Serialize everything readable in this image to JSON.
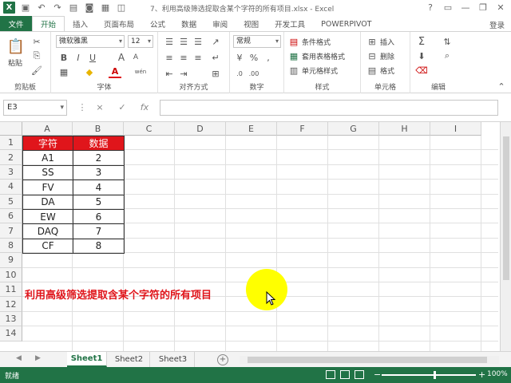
{
  "app": {
    "logo_letter": "X",
    "title": "7、利用高级筛选提取含某个字符的所有项目.xlsx - Excel",
    "login": "登录"
  },
  "quick_access": [
    "save-icon",
    "undo-icon",
    "redo-icon",
    "open-icon",
    "camera-icon",
    "print-icon",
    "preview-icon"
  ],
  "tabs": [
    "文件",
    "开始",
    "插入",
    "页面布局",
    "公式",
    "数据",
    "审阅",
    "视图",
    "开发工具",
    "POWERPIVOT"
  ],
  "active_tab": "开始",
  "ribbon": {
    "clipboard": {
      "label": "剪贴板",
      "paste": "粘贴"
    },
    "font": {
      "label": "字体",
      "font_name": "微软雅黑",
      "font_size": "12",
      "bold": "B",
      "italic": "I",
      "underline": "U",
      "grow": "A",
      "shrink": "A",
      "font_color_letter": "A",
      "wen": "wén"
    },
    "alignment": {
      "label": "对齐方式"
    },
    "number": {
      "label": "数字",
      "format": "常规"
    },
    "styles": {
      "label": "样式",
      "conditional": "条件格式",
      "table": "套用表格格式",
      "cell_styles": "单元格样式"
    },
    "cells": {
      "label": "单元格",
      "insert": "插入",
      "delete": "删除",
      "format": "格式"
    },
    "editing": {
      "label": "编辑"
    }
  },
  "formula_bar": {
    "name_box": "E3",
    "cancel": "×",
    "enter": "✓",
    "fx": "fx",
    "value": ""
  },
  "sheet": {
    "columns": [
      "A",
      "B",
      "C",
      "D",
      "E",
      "F",
      "G",
      "H",
      "I"
    ],
    "rows": [
      "1",
      "2",
      "3",
      "4",
      "5",
      "6",
      "7",
      "8",
      "9",
      "10",
      "11",
      "12",
      "13",
      "14"
    ],
    "table_header": [
      "字符",
      "数据"
    ],
    "table_rows": [
      [
        "A1",
        "2"
      ],
      [
        "SS",
        "3"
      ],
      [
        "FV",
        "4"
      ],
      [
        "DA",
        "5"
      ],
      [
        "EW",
        "6"
      ],
      [
        "DAQ",
        "7"
      ],
      [
        "CF",
        "8"
      ]
    ],
    "note": "利用高级筛选提取含某个字符的所有项目",
    "colors": {
      "header_fill": "#e0151b",
      "note_color": "#e0151b",
      "highlight": "#ffff00"
    }
  },
  "sheet_tabs": [
    "Sheet1",
    "Sheet2",
    "Sheet3"
  ],
  "active_sheet": "Sheet1",
  "status": {
    "text": "就绪",
    "zoom": "100%",
    "zoom_minus": "−",
    "zoom_plus": "+"
  },
  "accent": "#217346"
}
